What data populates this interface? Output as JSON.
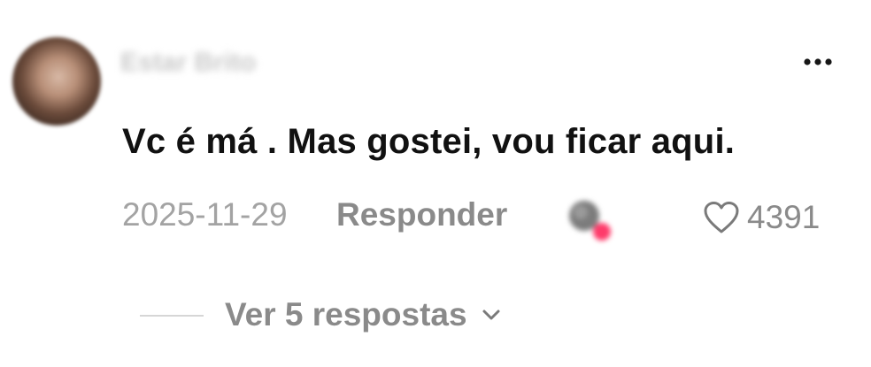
{
  "comment": {
    "username": "Estar Brito",
    "text": "Vc é má . Mas gostei, vou ficar aqui.",
    "date": "2025-11-29",
    "reply_label": "Responder",
    "likes": "4391",
    "replies_label": "Ver 5 respostas"
  },
  "icons": {
    "more": "more-horizontal-icon",
    "like": "heart-outline-icon",
    "expand": "chevron-down-icon"
  },
  "colors": {
    "text_primary": "#111111",
    "text_secondary": "#8a8a8a",
    "text_muted": "#a3a3a3"
  }
}
